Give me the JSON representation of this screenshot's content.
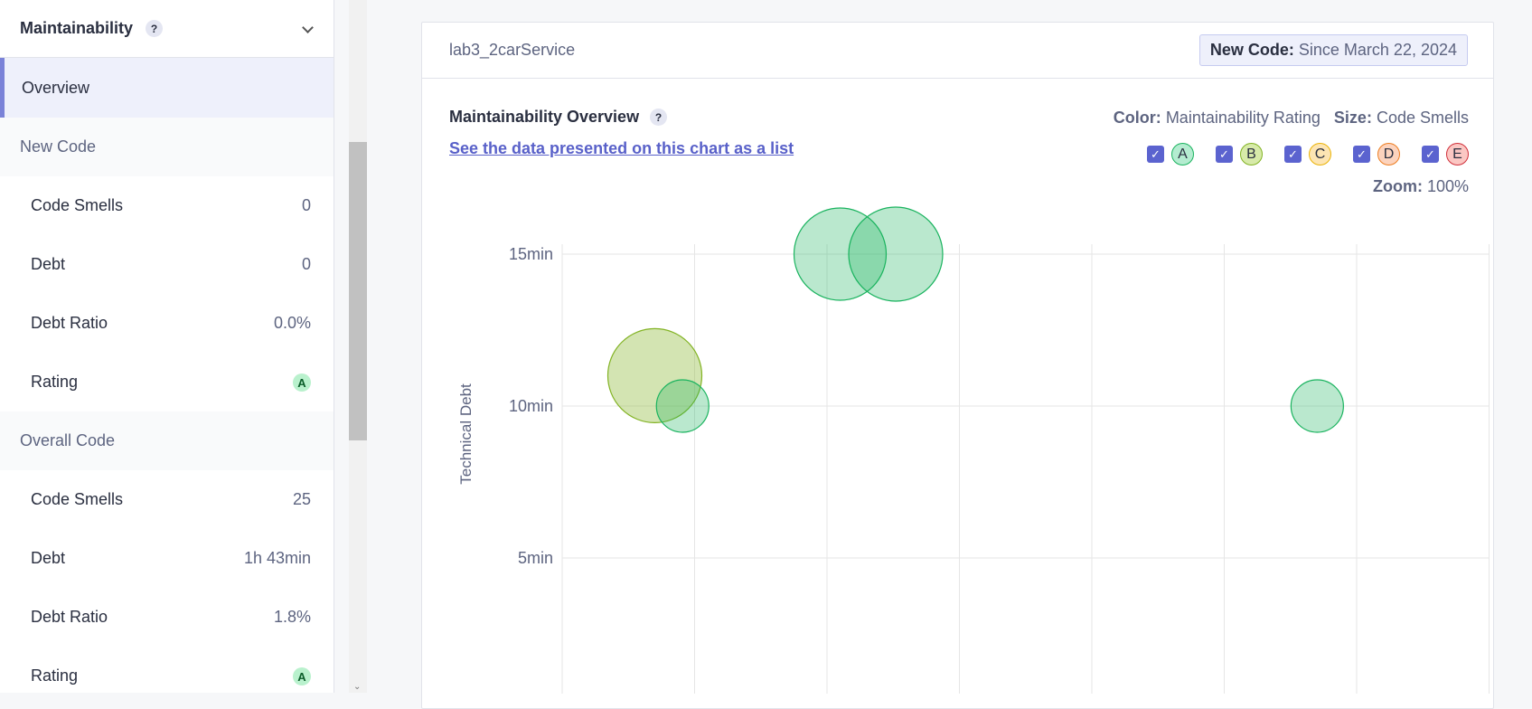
{
  "sidebar": {
    "title": "Maintainability",
    "help": "?",
    "overview": "Overview",
    "new_code": {
      "title": "New Code",
      "rows": [
        {
          "label": "Code Smells",
          "value": "0"
        },
        {
          "label": "Debt",
          "value": "0"
        },
        {
          "label": "Debt Ratio",
          "value": "0.0%"
        },
        {
          "label": "Rating",
          "value": "A"
        }
      ]
    },
    "overall_code": {
      "title": "Overall Code",
      "rows": [
        {
          "label": "Code Smells",
          "value": "25"
        },
        {
          "label": "Debt",
          "value": "1h 43min"
        },
        {
          "label": "Debt Ratio",
          "value": "1.8%"
        },
        {
          "label": "Rating",
          "value": "A"
        }
      ]
    }
  },
  "card": {
    "project": "lab3_2carService",
    "new_code_label": "New Code:",
    "new_code_value": "Since March 22, 2024",
    "chart_title": "Maintainability Overview",
    "help": "?",
    "list_link": "See the data presented on this chart as a list",
    "color_label": "Color:",
    "color_value": "Maintainability Rating",
    "size_label": "Size:",
    "size_value": "Code Smells",
    "zoom_label": "Zoom:",
    "zoom_value": "100%",
    "filters": [
      {
        "label": "A",
        "fill": "#b4ecd0",
        "border": "#19b35e"
      },
      {
        "label": "B",
        "fill": "#d7eaa9",
        "border": "#82b323"
      },
      {
        "label": "C",
        "fill": "#fde5b3",
        "border": "#eab308"
      },
      {
        "label": "D",
        "fill": "#fcd3bd",
        "border": "#ed7d20"
      },
      {
        "label": "E",
        "fill": "#fbc7c3",
        "border": "#d02f3a"
      }
    ]
  },
  "chart_data": {
    "type": "scatter",
    "ylabel": "Technical Debt",
    "yticks": [
      "15min",
      "10min",
      "5min"
    ],
    "y_values": [
      15,
      10,
      5
    ],
    "points": [
      {
        "x": 0.1,
        "y": 11,
        "r": 52,
        "rating": "B"
      },
      {
        "x": 0.13,
        "y": 10,
        "r": 29,
        "rating": "A"
      },
      {
        "x": 0.3,
        "y": 15,
        "r": 51,
        "rating": "A"
      },
      {
        "x": 0.36,
        "y": 15,
        "r": 52,
        "rating": "A"
      },
      {
        "x": 0.815,
        "y": 10,
        "r": 29,
        "rating": "A"
      }
    ],
    "colors": {
      "A": {
        "fill": "rgba(25,179,94,0.3)",
        "stroke": "#19b35e"
      },
      "B": {
        "fill": "rgba(130,179,35,0.35)",
        "stroke": "#82b323"
      }
    }
  }
}
